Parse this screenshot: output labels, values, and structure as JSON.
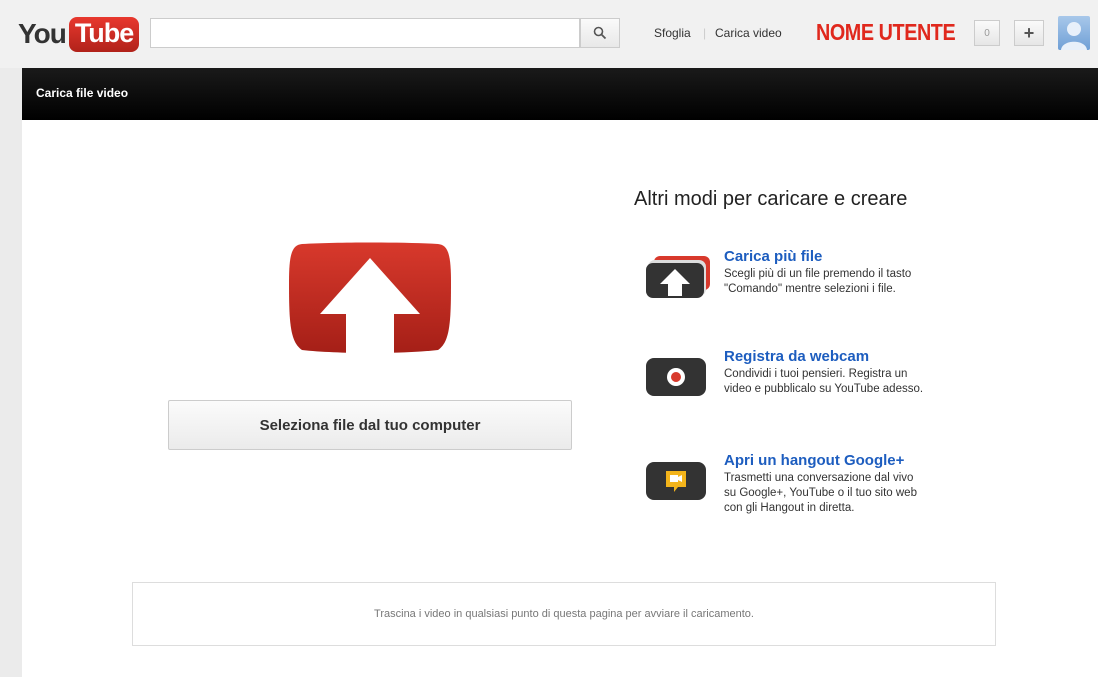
{
  "masthead": {
    "logo": {
      "you": "You",
      "tube": "Tube"
    },
    "search": {
      "value": "",
      "placeholder": ""
    },
    "nav": {
      "browse": "Sfoglia",
      "upload": "Carica video"
    },
    "username": "NOME UTENTE",
    "notification_count": "0",
    "create_label": "+"
  },
  "header": {
    "title": "Carica file video"
  },
  "main": {
    "select_file_label": "Seleziona file dal tuo computer",
    "other_ways": {
      "heading": "Altri modi per caricare e creare",
      "options": [
        {
          "title": "Carica più file",
          "description": "Scegli più di un file premendo il tasto\n\"Comando\" mentre selezioni i file.",
          "icon": "multi-upload-icon"
        },
        {
          "title": "Registra da webcam",
          "description": "Condividi i tuoi pensieri. Registra un\nvideo e pubblicalo su YouTube adesso.",
          "icon": "webcam-record-icon"
        },
        {
          "title": "Apri un hangout Google+",
          "description": "Trasmetti una conversazione dal vivo\nsu Google+, YouTube o il tuo sito web\ncon gli Hangout in diretta.",
          "icon": "hangout-icon"
        }
      ]
    },
    "drop_hint": "Trascina i video in qualsiasi punto di questa pagina per avviare il caricamento."
  },
  "colors": {
    "brand_red": "#d3281f",
    "link_blue": "#1d5dbf",
    "header_bar": "#000000",
    "username_red": "#e0281d"
  }
}
